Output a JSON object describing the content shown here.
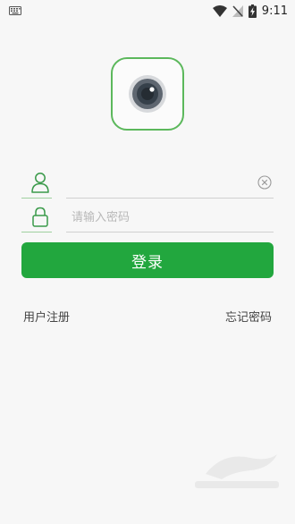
{
  "status_bar": {
    "time": "9:11",
    "icons": [
      "keyboard-icon",
      "wifi-icon",
      "no-signal-icon",
      "battery-charging-icon"
    ]
  },
  "logo": {
    "icon": "camera-lens-icon",
    "accent": "#5cb85c"
  },
  "login_form": {
    "username_icon": "user-icon",
    "username_value": "",
    "clear_icon": "clear-icon",
    "password_icon": "lock-icon",
    "password_placeholder": "请输入密码",
    "login_label": "登录"
  },
  "links": {
    "register": "用户注册",
    "forgot_password": "忘记密码"
  },
  "colors": {
    "primary": "#22a73e",
    "background": "#f7f7f7"
  }
}
